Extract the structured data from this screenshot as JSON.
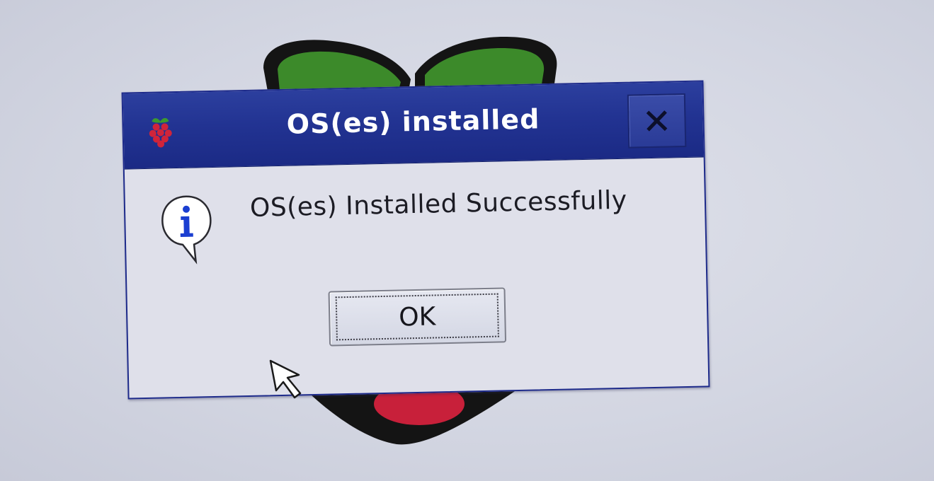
{
  "dialog": {
    "title": "OS(es) installed",
    "message": "OS(es) Installed Successfully",
    "ok_label": "OK"
  },
  "icons": {
    "app": "raspberry-icon",
    "close": "close-icon",
    "info": "info-bubble-icon",
    "cursor": "mouse-pointer-icon",
    "background": "raspberry-logo"
  },
  "colors": {
    "titlebar": "#223392",
    "dialog_background": "#dfe0ea",
    "desktop_background": "#d3d6e2",
    "raspberry_red": "#c8203a",
    "leaf_green": "#3c8a2a"
  }
}
